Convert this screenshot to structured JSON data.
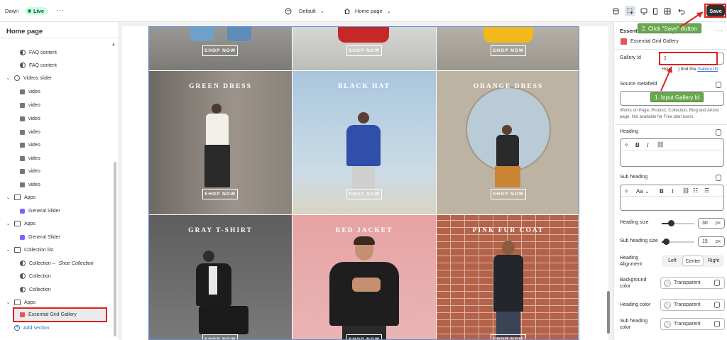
{
  "header": {
    "store_name": "Dawn",
    "live_badge": "Live",
    "more": "···",
    "theme_selector": "Default",
    "page_selector": "Home page",
    "save_label": "Save"
  },
  "sidebar": {
    "title": "Home page",
    "items": [
      {
        "label": "FAQ content",
        "type": "block-half"
      },
      {
        "label": "FAQ content",
        "type": "block-half"
      },
      {
        "label": "Videos slider",
        "type": "section-video"
      },
      {
        "label": "video",
        "type": "block-img"
      },
      {
        "label": "video",
        "type": "block-img"
      },
      {
        "label": "video",
        "type": "block-img"
      },
      {
        "label": "video",
        "type": "block-img"
      },
      {
        "label": "video",
        "type": "block-img"
      },
      {
        "label": "video",
        "type": "block-img"
      },
      {
        "label": "video",
        "type": "block-img"
      },
      {
        "label": "video",
        "type": "block-img"
      },
      {
        "label": "Apps",
        "type": "section"
      },
      {
        "label": "General Slider",
        "type": "app"
      },
      {
        "label": "Apps",
        "type": "section"
      },
      {
        "label": "General Slider",
        "type": "app"
      },
      {
        "label": "Collection list",
        "type": "section"
      },
      {
        "label": "Collection –",
        "label_italic": "Shoe Collection",
        "type": "block-half"
      },
      {
        "label": "Collection",
        "type": "block-half"
      },
      {
        "label": "Collection",
        "type": "block-half"
      },
      {
        "label": "Apps",
        "type": "section"
      },
      {
        "label": "Essential Grid Gallery",
        "type": "app-red"
      }
    ],
    "add_section": "Add section"
  },
  "preview": {
    "shop_now": "SHOP NOW",
    "tiles": [
      {
        "title": "",
        "bg": "#8a8a86"
      },
      {
        "title": "",
        "bg": "#c8c8c4"
      },
      {
        "title": "",
        "bg": "#a8a49c"
      },
      {
        "title": "GREEN DRESS",
        "bg": "#8e8680"
      },
      {
        "title": "BLACK HAT",
        "bg": "#b8cfe0"
      },
      {
        "title": "ORANGE DRESS",
        "bg": "#bdb3a2"
      },
      {
        "title": "GRAY T-SHIRT",
        "bg": "#6a6a6a"
      },
      {
        "title": "RED JACKET",
        "bg": "#e8a8a8"
      },
      {
        "title": "PINK FUR COAT",
        "bg": "#b5624a"
      }
    ]
  },
  "settings": {
    "section_title": "Essential Grid Gallery",
    "block_name": "Essential Grid Gallery",
    "gallery_id_label": "Gallery Id",
    "gallery_id_value": "1",
    "help_prefix": "How",
    "help_suffix": ") find the",
    "help_link": "Gallery ID",
    "source_metafield_label": "Source metafield",
    "metafield_note": "Works on Page, Product, Collection, Blog and Article page. Not available for Free plan users.",
    "heading_label": "Heading",
    "subheading_label": "Sub heading",
    "heading_size_label": "Heading size",
    "heading_size_value": "30",
    "subheading_size_label": "Sub heading size",
    "subheading_size_value": "15",
    "unit": "px",
    "heading_alignment_label": "Heading Alignment",
    "alignment_options": [
      "Left",
      "Center",
      "Right"
    ],
    "alignment_selected": "Center",
    "background_color_label": "Background color",
    "heading_color_label": "Heading color",
    "subheading_color_label": "Sub heading color",
    "transparent": "Transparent",
    "heading_size_fraction": 0.3,
    "subheading_size_fraction": 0.15
  },
  "annotations": {
    "step1": "1. Input Gallery Id",
    "step2": "2. Click \"Save\" Button",
    "arrow_color": "#e02020",
    "callout_color": "#6aa84f"
  }
}
